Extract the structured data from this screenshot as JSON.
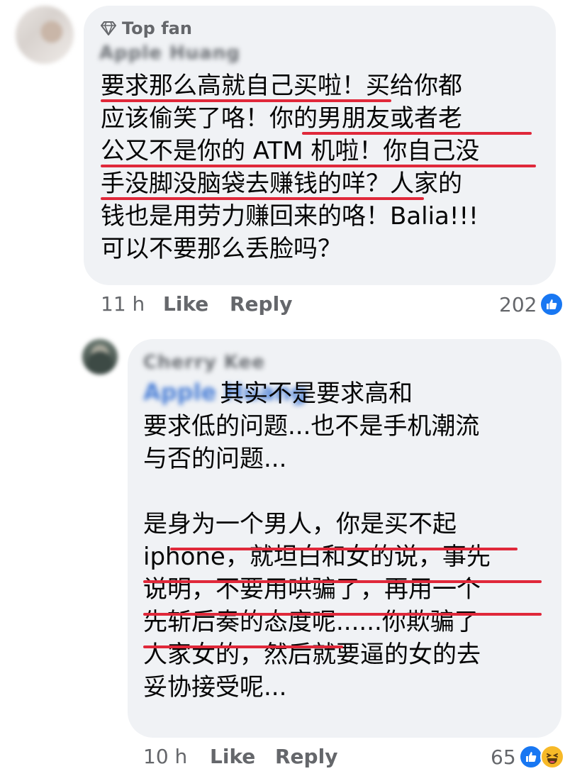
{
  "comment_1": {
    "badge": "Top fan",
    "author": "Apple Huang",
    "lines": [
      "要求那么高就自己买啦！买给你都",
      "应该偷笑了咯！你的男朋友或者老",
      "公又不是你的 ATM 机啦！你自己没",
      "手没脚没脑袋去赚钱的咩？人家的",
      "钱也是用劳力赚回来的咯！Balia!!!",
      "可以不要那么丢脸吗？"
    ],
    "time": "11 h",
    "like_label": "Like",
    "reply_label": "Reply",
    "reaction_count": "202",
    "reactions": [
      "like-icon"
    ]
  },
  "comment_2": {
    "author": "Cherry Kee",
    "mention": "Apple Huang",
    "lines": [
      "          其实不是要求高和",
      "要求低的问题...也不是手机潮流",
      "与否的问题...",
      "",
      "是身为一个男人，你是买不起",
      "iphone，就坦白和女的说，事先",
      "说明，不要用哄骗了，再用一个",
      "先斩后奏的态度呢......你欺骗了",
      "人家女的，然后就要逼的女的去",
      "妥协接受呢..."
    ],
    "time": "10 h",
    "like_label": "Like",
    "reply_label": "Reply",
    "reaction_count": "65",
    "reactions": [
      "like-icon",
      "haha-icon"
    ]
  },
  "colors": {
    "bubble": "#f0f2f5",
    "underline": "#e0283a",
    "meta": "#65676b",
    "like_blue": "#1877f2",
    "haha_yellow": "#f7b928"
  }
}
